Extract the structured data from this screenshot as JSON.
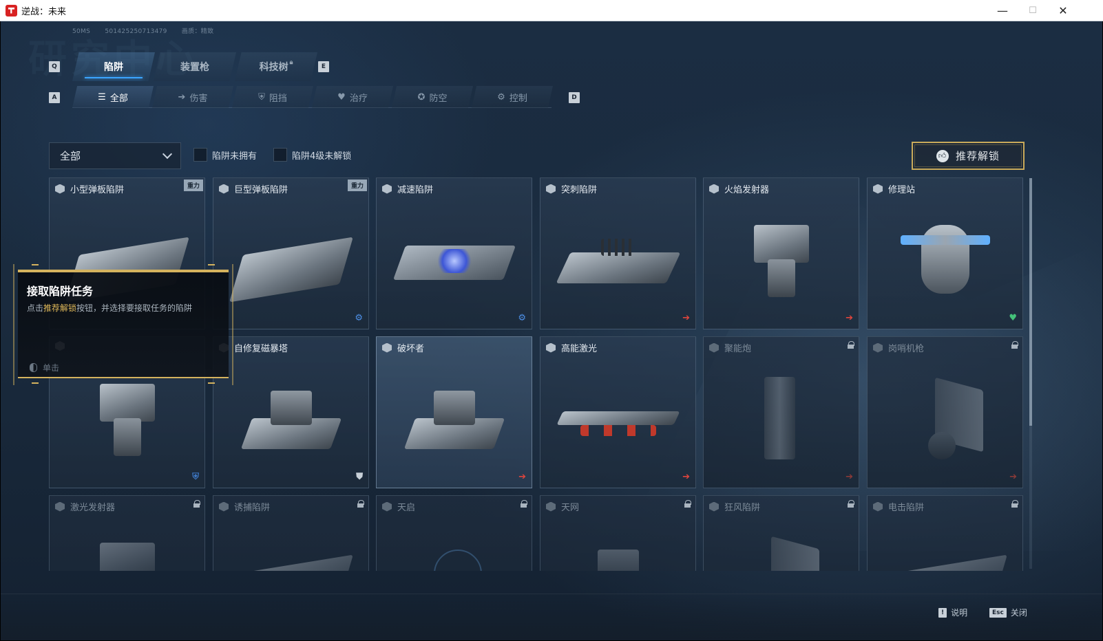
{
  "window": {
    "title": "逆战：未来",
    "minimize": "—",
    "maximize": "☐",
    "close": "✕"
  },
  "top_info": {
    "ping": "50MS",
    "id": "501425250713479",
    "quality": "画质：精致"
  },
  "bg_heading": "研究中心",
  "main_tabs": {
    "prev_key": "Q",
    "next_key": "E",
    "items": [
      {
        "label": "陷阱",
        "active": true
      },
      {
        "label": "装置枪",
        "active": false
      },
      {
        "label": "科技树",
        "active": false,
        "locked": true
      }
    ]
  },
  "sub_tabs": {
    "prev_key": "A",
    "next_key": "D",
    "items": [
      {
        "label": "全部",
        "icon": "list-icon",
        "glyph": "☰",
        "active": true
      },
      {
        "label": "伤害",
        "icon": "arrow-right-icon",
        "glyph": "➔",
        "active": false
      },
      {
        "label": "阻挡",
        "icon": "shield-icon",
        "glyph": "⛨",
        "active": false
      },
      {
        "label": "治疗",
        "icon": "heart-icon",
        "glyph": "♥",
        "active": false
      },
      {
        "label": "防空",
        "icon": "air-defense-icon",
        "glyph": "✪",
        "active": false
      },
      {
        "label": "控制",
        "icon": "gear-icon",
        "glyph": "⚙",
        "active": false
      }
    ]
  },
  "filters": {
    "dropdown_value": "全部",
    "not_owned": "陷阱未拥有",
    "lv4_locked": "陷阱4级未解锁",
    "recommend_button": "推荐解锁"
  },
  "tooltip": {
    "title": "接取陷阱任务",
    "desc_prefix": "点击",
    "desc_highlight": "推荐解锁",
    "desc_suffix": "按钮，并选择要接取任务的陷阱",
    "click_hint": "单击"
  },
  "cards": [
    {
      "name": "小型弹板陷阱",
      "badge": "重力",
      "status": "",
      "locked": false
    },
    {
      "name": "巨型弹板陷阱",
      "badge": "重力",
      "status": "control",
      "locked": false
    },
    {
      "name": "减速陷阱",
      "badge": "",
      "status": "control",
      "locked": false
    },
    {
      "name": "突刺陷阱",
      "badge": "",
      "status": "damage",
      "locked": false
    },
    {
      "name": "火焰发射器",
      "badge": "",
      "status": "damage",
      "locked": false
    },
    {
      "name": "修理站",
      "badge": "",
      "status": "heal",
      "locked": false
    },
    {
      "name": "",
      "badge": "",
      "status": "air",
      "locked": false
    },
    {
      "name": "自修复磁暴塔",
      "badge": "",
      "status": "block",
      "locked": false
    },
    {
      "name": "破坏者",
      "badge": "",
      "status": "damage",
      "locked": false,
      "selected": true
    },
    {
      "name": "高能激光",
      "badge": "",
      "status": "damage",
      "locked": false
    },
    {
      "name": "聚能炮",
      "badge": "",
      "status": "damage",
      "locked": true
    },
    {
      "name": "岗哨机枪",
      "badge": "",
      "status": "damage",
      "locked": true
    },
    {
      "name": "激光发射器",
      "badge": "",
      "status": "",
      "locked": true
    },
    {
      "name": "诱捕陷阱",
      "badge": "",
      "status": "",
      "locked": true
    },
    {
      "name": "天启",
      "badge": "",
      "status": "",
      "locked": true
    },
    {
      "name": "天网",
      "badge": "",
      "status": "",
      "locked": true
    },
    {
      "name": "狂风陷阱",
      "badge": "",
      "status": "",
      "locked": true
    },
    {
      "name": "电击陷阱",
      "badge": "",
      "status": "",
      "locked": true
    }
  ],
  "status_glyphs": {
    "damage": "➔",
    "control": "⚙",
    "air": "⛨",
    "block": "⛊",
    "heal": "♥"
  },
  "footer": {
    "help_key": "!",
    "help_label": "说明",
    "close_key": "Esc",
    "close_label": "关闭"
  }
}
